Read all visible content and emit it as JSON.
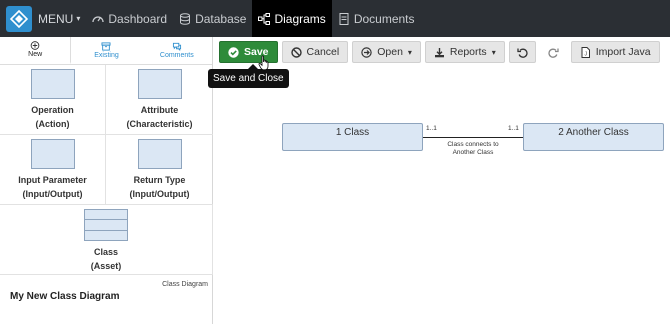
{
  "topbar": {
    "menu_label": "MENU",
    "nav": [
      {
        "label": "Dashboard"
      },
      {
        "label": "Database"
      },
      {
        "label": "Diagrams"
      },
      {
        "label": "Documents"
      }
    ]
  },
  "sidebar": {
    "tabs": [
      {
        "label": "New"
      },
      {
        "label": "Existing"
      },
      {
        "label": "Comments"
      }
    ],
    "palette": [
      {
        "line1": "Operation",
        "line2": "(Action)"
      },
      {
        "line1": "Attribute",
        "line2": "(Characteristic)"
      },
      {
        "line1": "Input Parameter",
        "line2": "(Input/Output)"
      },
      {
        "line1": "Return Type",
        "line2": "(Input/Output)"
      },
      {
        "line1": "Class",
        "line2": "(Asset)"
      }
    ],
    "diagram_type": "Class Diagram",
    "diagram_name": "My New Class Diagram"
  },
  "toolbar": {
    "save_label": "Save",
    "cancel_label": "Cancel",
    "open_label": "Open",
    "reports_label": "Reports",
    "import_label": "Import Java",
    "tooltip": "Save and Close"
  },
  "canvas": {
    "class1": "1 Class",
    "class2": "2 Another Class",
    "mult_left": "1..1",
    "mult_right": "1..1",
    "connector_label": "Class connects to Another Class"
  },
  "colors": {
    "topbar_bg": "#2b2f34",
    "save_green": "#2e8b3a",
    "accent_blue": "#2f8fce",
    "class_fill": "#dbe7f4"
  }
}
